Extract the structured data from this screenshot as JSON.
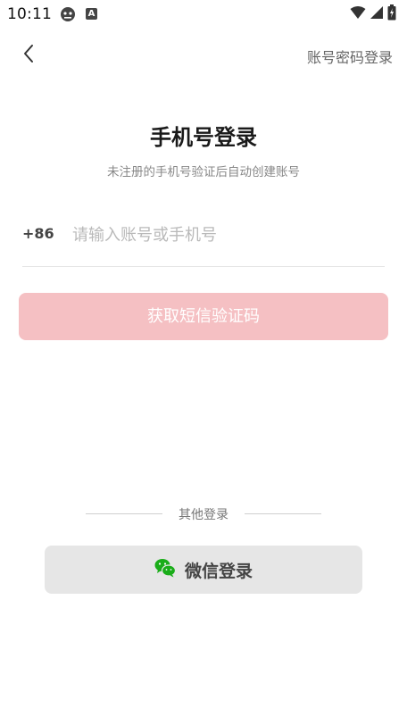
{
  "status_bar": {
    "time": "10:11",
    "left_icons": [
      "developer-icon",
      "a-icon"
    ],
    "a_icon_text": "A",
    "right_icons": [
      "wifi-icon",
      "signal-icon",
      "battery-icon"
    ]
  },
  "nav": {
    "back_icon": "chevron-left-icon",
    "password_login_label": "账号密码登录"
  },
  "main": {
    "title": "手机号登录",
    "subtitle": "未注册的手机号验证后自动创建账号",
    "country_code": "+86",
    "phone_placeholder": "请输入账号或手机号",
    "phone_value": "",
    "sms_button_label": "获取短信验证码"
  },
  "other": {
    "label": "其他登录",
    "wechat_label": "微信登录",
    "wechat_icon": "wechat-icon"
  },
  "colors": {
    "sms_button_bg": "#f5c0c3",
    "wechat_green": "#1aad19",
    "wechat_button_bg": "#e6e6e6"
  }
}
